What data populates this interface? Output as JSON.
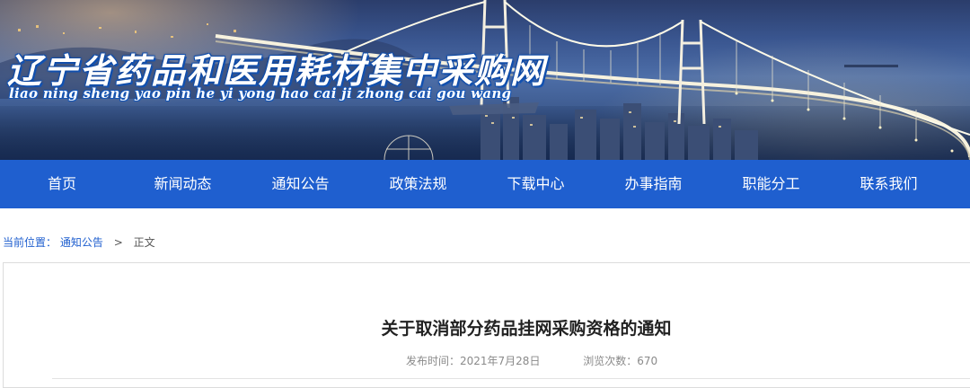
{
  "header": {
    "title": "辽宁省药品和医用耗材集中采购网",
    "subtitle": "liao ning sheng yao pin he yi yong hao cai ji zhong cai gou wang"
  },
  "nav": {
    "items": [
      {
        "label": "首页"
      },
      {
        "label": "新闻动态"
      },
      {
        "label": "通知公告"
      },
      {
        "label": "政策法规"
      },
      {
        "label": "下载中心"
      },
      {
        "label": "办事指南"
      },
      {
        "label": "职能分工"
      },
      {
        "label": "联系我们"
      }
    ]
  },
  "breadcrumb": {
    "prefix": "当前位置：",
    "section": "通知公告",
    "separator": ">",
    "current": "正文"
  },
  "article": {
    "title": "关于取消部分药品挂网采购资格的通知",
    "publish_label": "发布时间：2021年7月28日",
    "views_label": "浏览次数：670"
  },
  "colors": {
    "nav_bg": "#1f5fcf",
    "link": "#1f5fcf",
    "title_outline": "#1456b8"
  },
  "icons": {
    "banner": "suspension-bridge-night-scene"
  }
}
